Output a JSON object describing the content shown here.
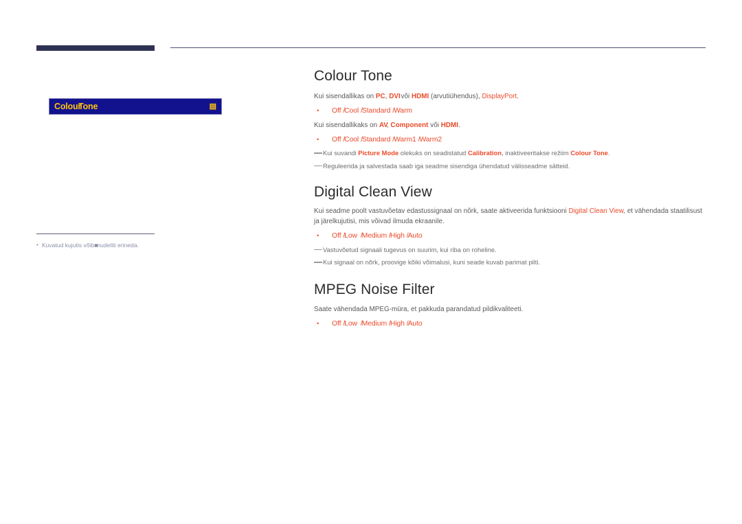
{
  "page": {
    "left_note": {
      "bullet": "•",
      "text_parts": [
        "Kuvatud kujutis võib",
        "mudeliti erineda."
      ]
    },
    "menu_box": {
      "label_part1": "Colour",
      "label_part2": "Tone",
      "icon": "enter-icon",
      "icon_glyph": "↵"
    }
  },
  "sections": [
    {
      "id": "colour-tone",
      "title": "Colour Tone",
      "paragraph1_pre": "Kui sisendallikas on ",
      "paragraph1_hl1": "PC",
      "paragraph1_mid1": ", ",
      "paragraph1_hl2": "DVI",
      "paragraph1_mid2": " või ",
      "paragraph1_hl3": "HDMI",
      "paragraph1_mid3": " (arvutiühendus), ",
      "paragraph1_hl4": "DisplayPort",
      "paragraph1_end": ".",
      "options1": [
        "Off",
        "Cool",
        "Standard",
        "Warm"
      ],
      "paragraph2_pre": "Kui sisendallikaks on ",
      "paragraph2_hl1": "AV",
      "paragraph2_mid1": ", ",
      "paragraph2_hl2": "Component",
      "paragraph2_mid2": " või ",
      "paragraph2_hl3": "HDMI",
      "paragraph2_end": ".",
      "options2": [
        "Off",
        "Cool",
        "Standard",
        "Warm1",
        "Warm2"
      ],
      "note1_pre": "Kui suvandi ",
      "note1_hl1": "Picture Mode",
      "note1_mid1": " olekuks on seadistatud ",
      "note1_hl2": "Calibration",
      "note1_mid2": ", inaktiveeritakse režiim ",
      "note1_hl3": "Colour Tone",
      "note1_end": ".",
      "note2": "Reguleerida ja salvestada saab iga seadme sisendiga ühendatud välisseadme sätteid."
    },
    {
      "id": "digital-clean-view",
      "title": "Digital Clean View",
      "paragraph1_pre": "Kui seadme poolt vastuvõetav edastussignaal on nõrk, saate aktiveerida funktsiooni ",
      "paragraph1_hl1": "Digital Clean View",
      "paragraph1_end": ", et vähendada staatilisust ja järelkujutisi, mis võivad ilmuda ekraanile.",
      "options1": [
        "Off",
        "Low",
        "Medium",
        "High",
        "Auto"
      ],
      "note1": "Vastuvõetud signaali tugevus on suurim, kui riba on roheline.",
      "note2": "Kui signaal on nõrk, proovige kõiki võimalusi, kuni seade kuvab parimat pilti."
    },
    {
      "id": "mpeg-noise-filter",
      "title": "MPEG Noise Filter",
      "paragraph1": "Saate vähendada MPEG-müra, et pakkuda parandatud pildikvaliteeti.",
      "options1": [
        "Off",
        "Low",
        "Medium",
        "High",
        "Auto"
      ]
    }
  ],
  "colors": {
    "accent_red": "#ea4a2a",
    "menu_blue": "#12128e",
    "menu_yellow": "#ffc20e",
    "rule_navy": "#2e3252"
  }
}
